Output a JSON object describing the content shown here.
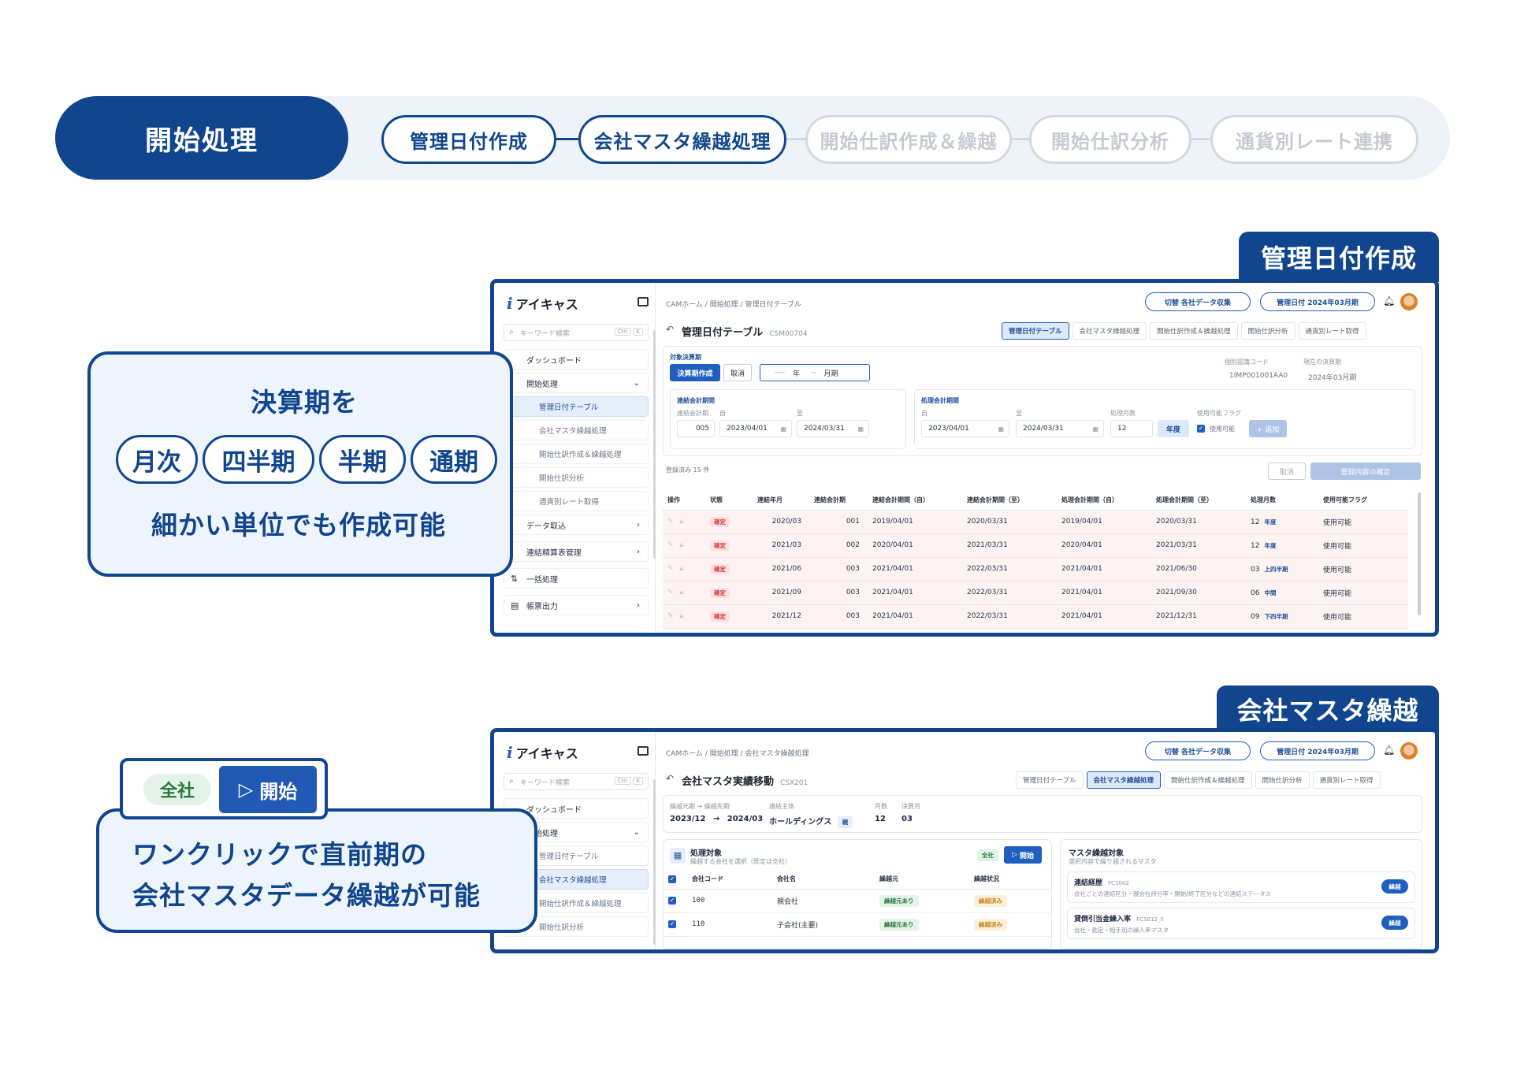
{
  "flow": {
    "main": "開始処理",
    "steps": [
      "管理日付作成",
      "会社マスタ繰越処理",
      "開始仕訳作成＆繰越",
      "開始仕訳分析",
      "通貨別レート連携"
    ]
  },
  "section1": {
    "tab": "管理日付作成",
    "callout": {
      "line1": "決算期を",
      "chips": [
        "月次",
        "四半期",
        "半期",
        "通期"
      ],
      "line3": "細かい単位でも作成可能"
    }
  },
  "section2": {
    "tab": "会社マスタ繰越",
    "mini": {
      "scope": "全社",
      "start": "開始"
    },
    "callout": {
      "line1": "ワンクリックで直前期の",
      "line2": "会社マスタデータ繰越が可能"
    }
  },
  "app": {
    "brand": "アイキャス",
    "search_placeholder": "キーワード検索",
    "kbd1": "Ctrl",
    "kbd2": "K",
    "switch_btn": "切替  各社データ収集",
    "mgmt_date_btn": "管理日付  2024年03月期",
    "tabs": [
      "管理日付テーブル",
      "会社マスタ繰越処理",
      "開始仕訳作成＆繰越処理",
      "開始仕訳分析",
      "通貨別レート取得"
    ]
  },
  "screen1": {
    "breadcrumb": "CAMホーム / 開始処理 / 管理日付テーブル",
    "title": "管理日付テーブル",
    "code": "CSM00704",
    "sidebar": [
      "ダッシュボード",
      "開始処理",
      "管理日付テーブル",
      "会社マスタ繰越処理",
      "開始仕訳作成＆繰越処理",
      "開始仕訳分析",
      "通貨別レート取得",
      "データ取込",
      "連結精算表管理",
      "一括処理",
      "帳票出力"
    ],
    "target_label": "対象決算期",
    "create_btn": "決算期作成",
    "cancel_btn": "取消",
    "year_placeholder": "----",
    "year_unit": "年",
    "month_placeholder": "--",
    "month_unit": "月期",
    "id_label": "個別認識コード",
    "id_value": "1IMP001001AA0",
    "current_label": "現在の決算期",
    "current_value": "2024年03月期",
    "cons_group": "連結会計期間",
    "cons_period_label": "連結会計期",
    "cons_period": "005",
    "from_label": "自",
    "to_label": "至",
    "cons_from": "2023/04/01",
    "cons_to": "2024/03/31",
    "proc_group": "処理会計期間",
    "proc_from": "2023/04/01",
    "proc_to": "2024/03/31",
    "months_label": "処理月数",
    "months": "12",
    "year_btn": "年度",
    "flag_label": "使用可能フラグ",
    "flag_value": "使用可能",
    "add_btn": "+ 追加",
    "count": "登録済み 15 件",
    "cancel_btn2": "取消",
    "confirm_btn": "登録内容の確定",
    "columns": [
      "操作",
      "状態",
      "連結年月",
      "連結会計期",
      "連結会計期間（自）",
      "連結会計期間（至）",
      "処理会計期間（自）",
      "処理会計期間（至）",
      "処理月数",
      "使用可能フラグ"
    ],
    "rows": [
      {
        "status": "確定",
        "ym": "2020/03",
        "period": "001",
        "cf": "2019/04/01",
        "ct": "2020/03/31",
        "pf": "2019/04/01",
        "pt": "2020/03/31",
        "months": "12",
        "kind": "年度",
        "flag": "使用可能"
      },
      {
        "status": "確定",
        "ym": "2021/03",
        "period": "002",
        "cf": "2020/04/01",
        "ct": "2021/03/31",
        "pf": "2020/04/01",
        "pt": "2021/03/31",
        "months": "12",
        "kind": "年度",
        "flag": "使用可能"
      },
      {
        "status": "確定",
        "ym": "2021/06",
        "period": "003",
        "cf": "2021/04/01",
        "ct": "2022/03/31",
        "pf": "2021/04/01",
        "pt": "2021/06/30",
        "months": "03",
        "kind": "上四半期",
        "flag": "使用可能"
      },
      {
        "status": "確定",
        "ym": "2021/09",
        "period": "003",
        "cf": "2021/04/01",
        "ct": "2022/03/31",
        "pf": "2021/04/01",
        "pt": "2021/09/30",
        "months": "06",
        "kind": "中間",
        "flag": "使用可能"
      },
      {
        "status": "確定",
        "ym": "2021/12",
        "period": "003",
        "cf": "2021/04/01",
        "ct": "2022/03/31",
        "pf": "2021/04/01",
        "pt": "2021/12/31",
        "months": "09",
        "kind": "下四半期",
        "flag": "使用可能"
      }
    ]
  },
  "screen2": {
    "breadcrumb": "CAMホーム / 開始処理 / 会社マスタ繰越処理",
    "title": "会社マスタ実績移動",
    "code": "CSX201",
    "sidebar": [
      "ダッシュボード",
      "開始処理",
      "管理日付テーブル",
      "会社マスタ繰越処理",
      "開始仕訳作成＆繰越処理",
      "開始仕訳分析"
    ],
    "move_label": "繰越元期 → 繰越先期",
    "move_from": "2023/12",
    "arrow": "→",
    "move_to": "2024/03",
    "entity_label": "連結主体",
    "entity_value": "ホールディングス",
    "entity_badge": "親",
    "months_label": "月数",
    "months_value": "12",
    "fy_label": "決算月",
    "fy_value": "03",
    "target_title": "処理対象",
    "target_sub": "繰越する会社を選択（既定は全社）",
    "scope": "全社",
    "start": "開始",
    "columns": [
      "会社コード",
      "会社名",
      "繰越元",
      "繰越状況"
    ],
    "rows": [
      {
        "code": "100",
        "name": "親会社",
        "src": "繰越元あり",
        "state": "繰越済み"
      },
      {
        "code": "110",
        "name": "子会社(主要)",
        "src": "繰越元あり",
        "state": "繰越済み"
      }
    ],
    "master_title": "マスタ繰越対象",
    "master_sub": "選択内容で繰り越されるマスタ",
    "masters": [
      {
        "name": "連結経歴",
        "code": "FCS002",
        "desc": "会社ごとの連結区分・親会社持分率・開始/終了区分などの連結ステータス",
        "btn": "繰越"
      },
      {
        "name": "貸倒引当金繰入率",
        "code": "FCS012_S",
        "desc": "会社・勘定・相手別の繰入率マスタ",
        "btn": "繰越"
      }
    ]
  }
}
